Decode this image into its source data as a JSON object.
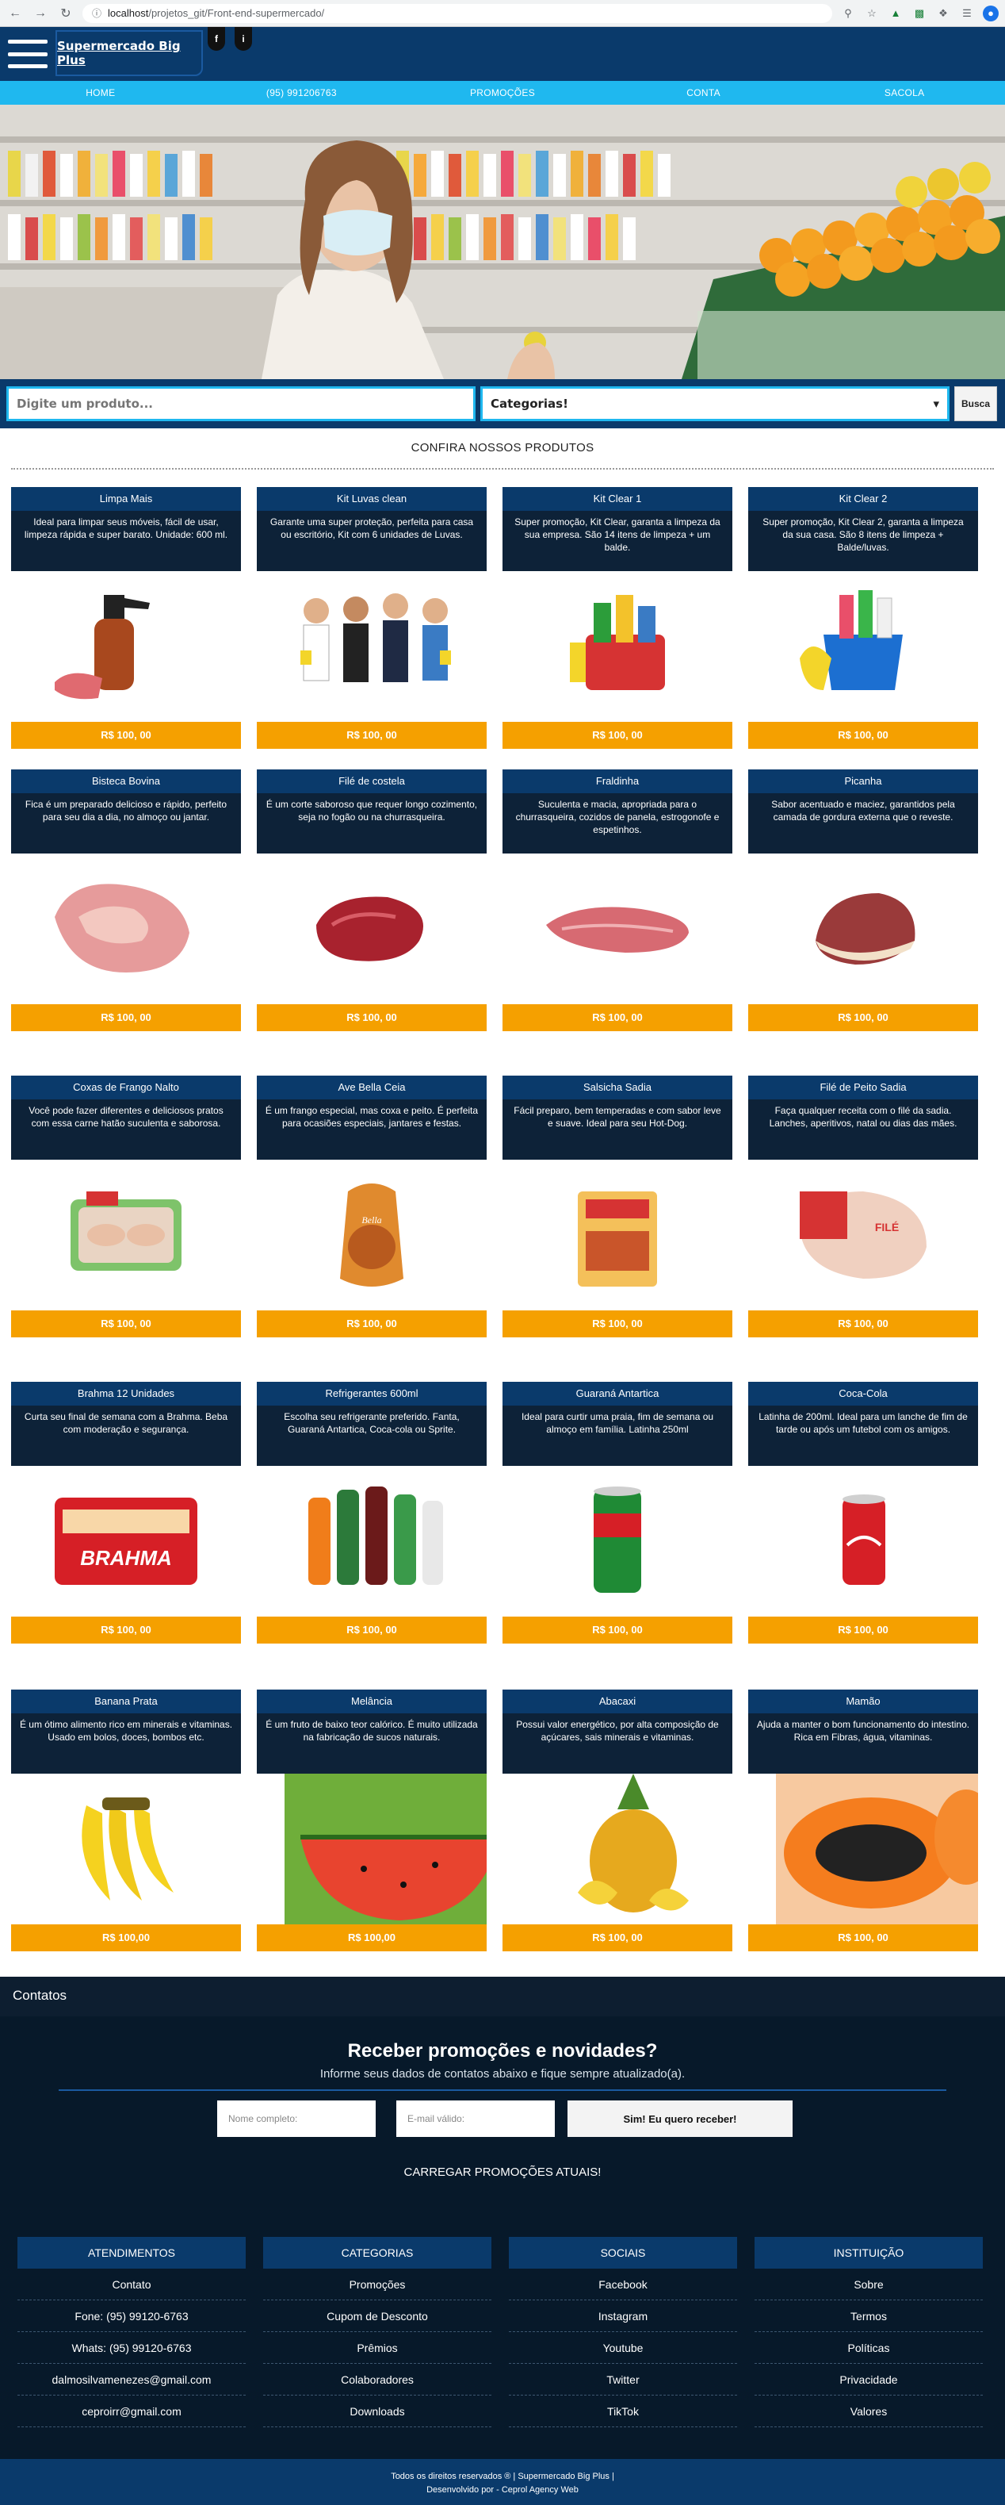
{
  "browser": {
    "url_host": "localhost",
    "url_path": "/projetos_git/Front-end-supermercado/"
  },
  "header": {
    "brand": "Supermercado Big Plus",
    "social": [
      "f",
      "i"
    ],
    "nav": [
      "HOME",
      "(95) 991206763",
      "PROMOÇÕES",
      "CONTA",
      "SACOLA"
    ]
  },
  "search": {
    "placeholder": "Digite um produto...",
    "category": "Categorias!",
    "button": "Busca"
  },
  "section_title": "CONFIRA NOSSOS PRODUTOS",
  "products": [
    {
      "name": "Limpa Mais",
      "desc": "Ideal para limpar seus móveis, fácil de usar, limpeza rápida e super barato. Unidade: 600 ml.",
      "price": "R$ 100, 00",
      "icon": "spray-bottle"
    },
    {
      "name": "Kit Luvas clean",
      "desc": "Garante uma super proteção, perfeita para casa ou escritório, Kit com 6 unidades de Luvas.",
      "price": "R$ 100, 00",
      "icon": "cleaning-team"
    },
    {
      "name": "Kit Clear 1",
      "desc": "Super promoção, Kit Clear, garanta a limpeza da sua empresa. São 14 itens de limpeza + um balde.",
      "price": "R$ 100, 00",
      "icon": "cleaning-kit"
    },
    {
      "name": "Kit Clear 2",
      "desc": "Super promoção, Kit Clear 2, garanta a limpeza da sua casa. São 8 itens de limpeza + Balde/luvas.",
      "price": "R$ 100, 00",
      "icon": "cleaning-bucket"
    },
    {
      "name": "Bisteca Bovina",
      "desc": "Fica é um preparado delicioso e rápido, perfeito para seu dia a dia, no almoço ou jantar.",
      "price": "R$ 100, 00",
      "icon": "pork-chop"
    },
    {
      "name": "Filé de costela",
      "desc": "É um corte saboroso que requer longo cozimento, seja no fogão ou na churrasqueira.",
      "price": "R$ 100, 00",
      "icon": "rib-steak"
    },
    {
      "name": "Fraldinha",
      "desc": "Suculenta e macia, apropriada para o churrasqueira, cozidos de panela, estrogonofe e espetinhos.",
      "price": "R$ 100, 00",
      "icon": "flank-steak"
    },
    {
      "name": "Picanha",
      "desc": "Sabor acentuado e maciez, garantidos pela camada de gordura externa que o reveste.",
      "price": "R$ 100, 00",
      "icon": "picanha"
    },
    {
      "name": "Coxas de Frango Nalto",
      "desc": "Você pode fazer diferentes e deliciosos pratos com essa carne hatão suculenta e saborosa.",
      "price": "R$ 100, 00",
      "icon": "chicken-pack"
    },
    {
      "name": "Ave Bella Ceia",
      "desc": "É um frango especial, mas coxa e peito. É perfeita para ocasiões especiais, jantares e festas.",
      "price": "R$ 100, 00",
      "icon": "whole-chicken"
    },
    {
      "name": "Salsicha Sadia",
      "desc": "Fácil preparo, bem temperadas e com sabor leve e suave. Ideal para seu Hot-Dog.",
      "price": "R$ 100, 00",
      "icon": "hotdog-pack"
    },
    {
      "name": "Filé de Peito Sadia",
      "desc": "Faça qualquer receita com o filé da sadia. Lanches, aperitivos, natal ou dias das mães.",
      "price": "R$ 100, 00",
      "icon": "breast-fillet"
    },
    {
      "name": "Brahma 12 Unidades",
      "desc": "Curta seu final de semana com a Brahma. Beba com moderação e segurança.",
      "price": "R$ 100, 00",
      "icon": "beer-pack"
    },
    {
      "name": "Refrigerantes 600ml",
      "desc": "Escolha seu refrigerante preferido. Fanta, Guaraná Antartica, Coca-cola ou Sprite.",
      "price": "R$ 100, 00",
      "icon": "soda-bottles"
    },
    {
      "name": "Guaraná Antartica",
      "desc": "Ideal para curtir uma praia, fim de semana ou almoço em família. Latinha 250ml",
      "price": "R$ 100, 00",
      "icon": "guarana-can"
    },
    {
      "name": "Coca-Cola",
      "desc": "Latinha de 200ml. Ideal para um lanche de fim de tarde ou após um futebol com os amigos.",
      "price": "R$ 100, 00",
      "icon": "coke-can"
    },
    {
      "name": "Banana Prata",
      "desc": "É um ótimo alimento rico em minerais e vitaminas. Usado em bolos, doces, bombos etc.",
      "price": "R$ 100,00",
      "icon": "bananas"
    },
    {
      "name": "Melância",
      "desc": "É um fruto de baixo teor calórico. É muito utilizada na fabricação de sucos naturais.",
      "price": "R$ 100,00",
      "icon": "watermelon"
    },
    {
      "name": "Abacaxi",
      "desc": "Possui valor energético, por alta composição de açúcares, sais minerais e vitaminas.",
      "price": "R$ 100, 00",
      "icon": "pineapple"
    },
    {
      "name": "Mamão",
      "desc": "Ajuda a manter o bom funcionamento do intestino. Rica em Fibras, água, vitaminas.",
      "price": "R$ 100, 00",
      "icon": "papaya"
    }
  ],
  "footer": {
    "contatos": "Contatos",
    "newsletter_title": "Receber promoções e novidades?",
    "newsletter_sub": "Informe seus dados de contatos abaixo e fique sempre atualizado(a).",
    "name_placeholder": "Nome completo:",
    "email_placeholder": "E-mail válido:",
    "submit": "Sim! Eu quero receber!",
    "load": "CARREGAR PROMOÇÕES ATUAIS!",
    "columns": [
      {
        "head": "ATENDIMENTOS",
        "items": [
          "Contato",
          "Fone: (95) 99120-6763",
          "Whats: (95) 99120-6763",
          "dalmosilvamenezes@gmail.com",
          "ceproirr@gmail.com"
        ]
      },
      {
        "head": "CATEGORIAS",
        "items": [
          "Promoções",
          "Cupom de Desconto",
          "Prêmios",
          "Colaboradores",
          "Downloads"
        ]
      },
      {
        "head": "SOCIAIS",
        "items": [
          "Facebook",
          "Instagram",
          "Youtube",
          "Twitter",
          "TikTok"
        ]
      },
      {
        "head": "INSTITUIÇÃO",
        "items": [
          "Sobre",
          "Termos",
          "Políticas",
          "Privacidade",
          "Valores"
        ]
      }
    ],
    "copyright": "Todos os direitos reservados ® | Supermercado Big Plus |",
    "credit": "Desenvolvido por - Ceprol Agency Web"
  }
}
